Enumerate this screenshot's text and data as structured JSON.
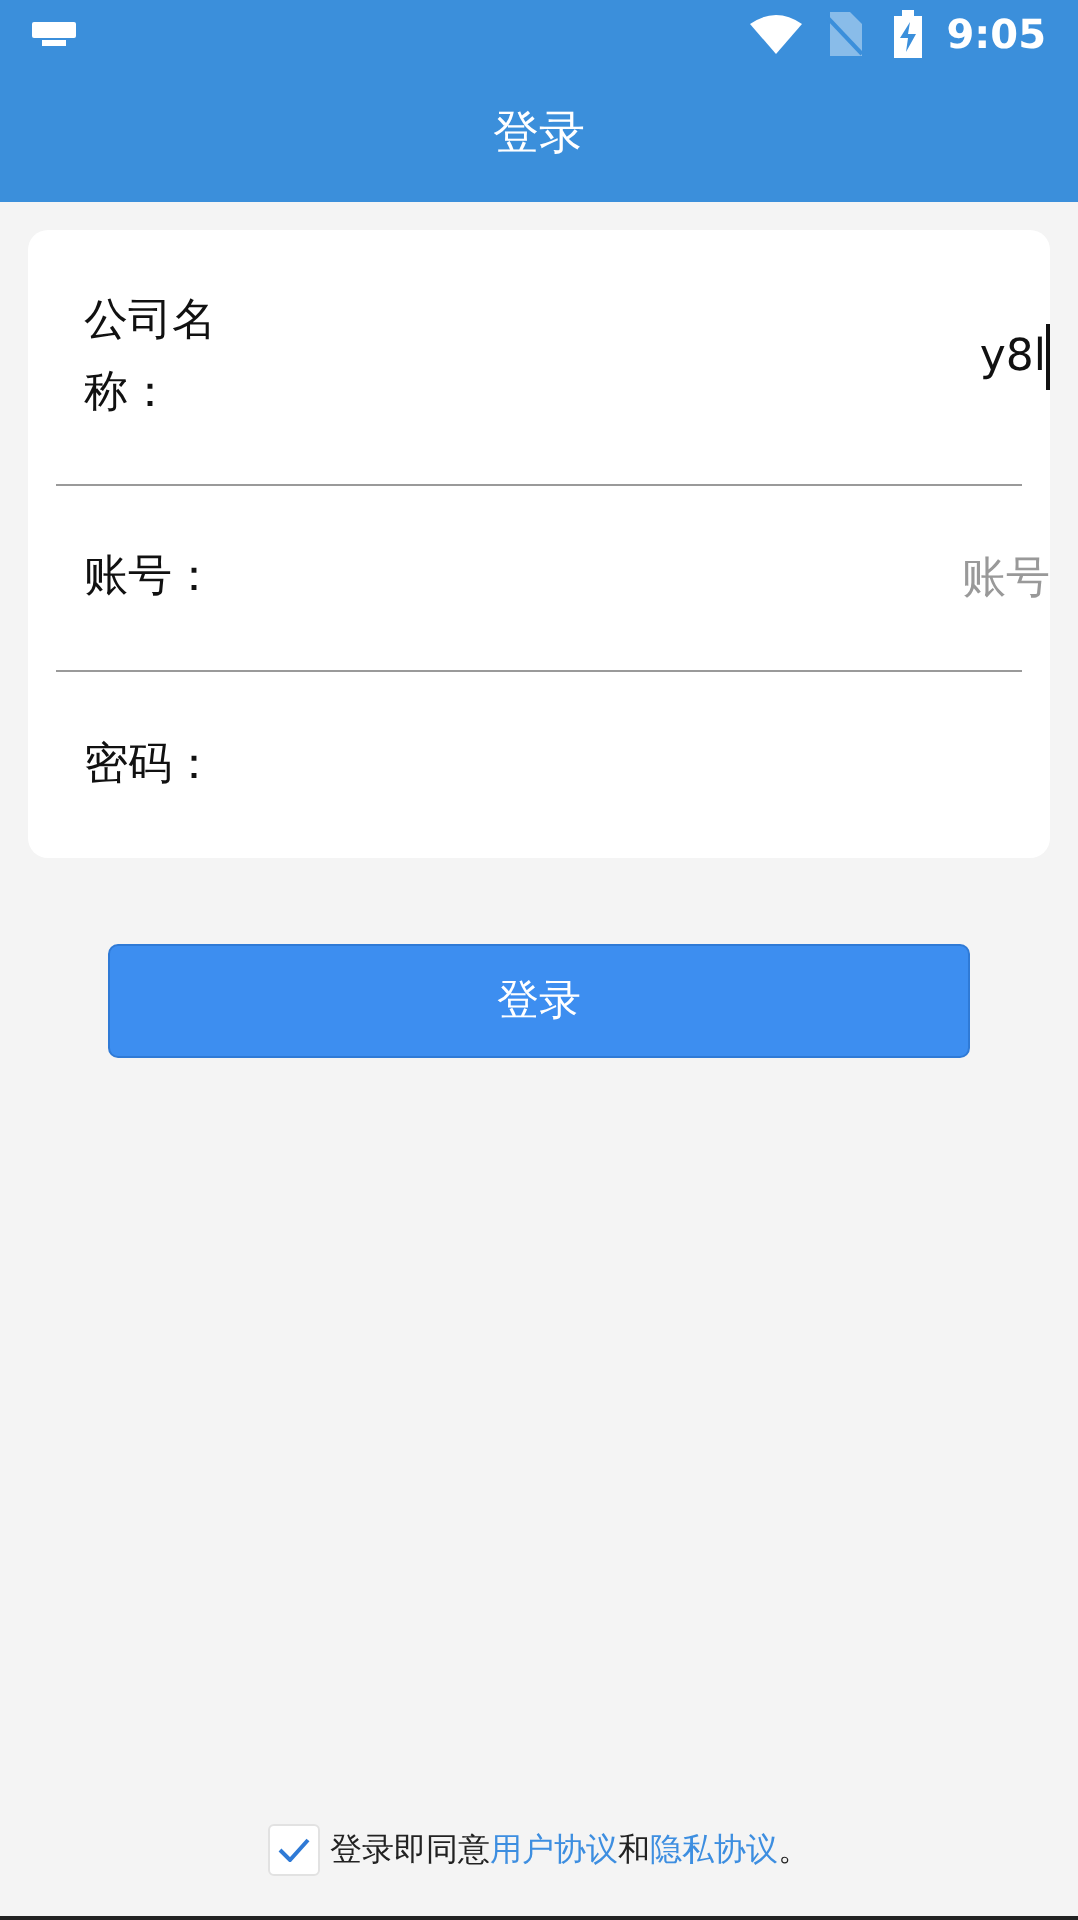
{
  "status_bar": {
    "time": "9:05"
  },
  "header": {
    "title": "登录"
  },
  "form": {
    "fields": [
      {
        "label": "公司名称：",
        "value": "y8l",
        "focused": true
      },
      {
        "label": "账号：",
        "placeholder": "账号",
        "focused": false
      },
      {
        "label": "密码：",
        "focused": false
      }
    ]
  },
  "login_button": "登录",
  "agreement": {
    "checked": true,
    "parts": [
      {
        "kind": "text",
        "text": "登录即同意"
      },
      {
        "kind": "link",
        "text": "用户协议"
      },
      {
        "kind": "text",
        "text": "和"
      },
      {
        "kind": "link",
        "text": "隐私协议"
      },
      {
        "kind": "text",
        "text": "。"
      }
    ]
  }
}
